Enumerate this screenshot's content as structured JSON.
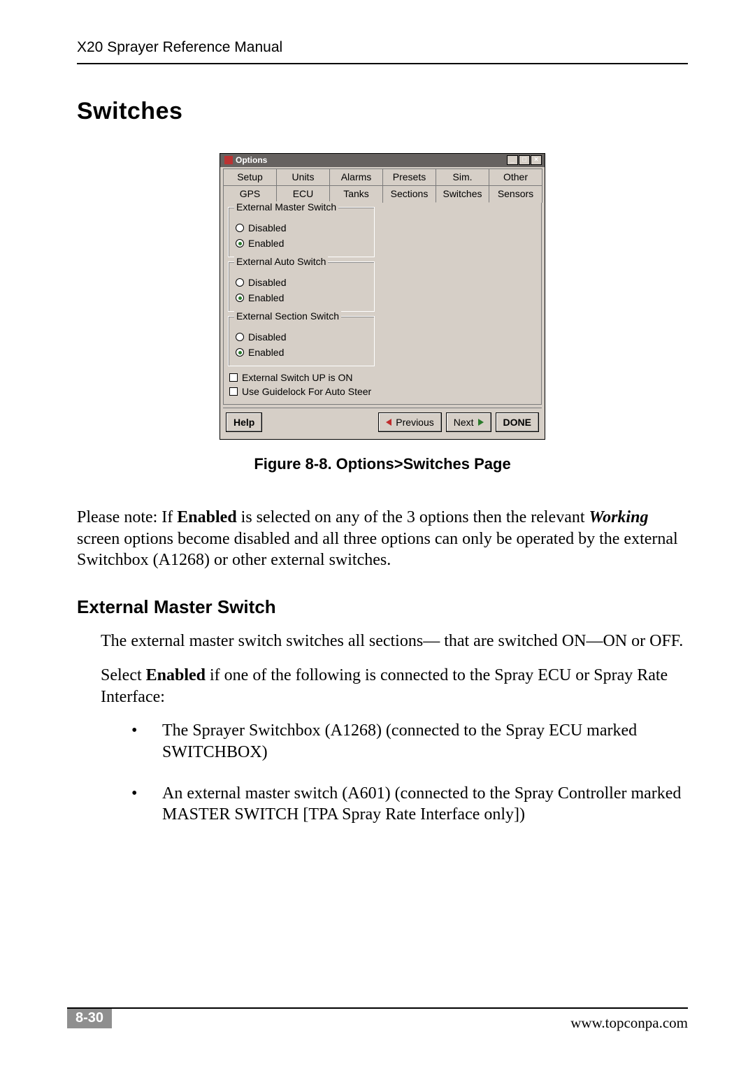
{
  "header_text": "X20 Sprayer Reference Manual",
  "section_title": "Switches",
  "dialog": {
    "title": "Options",
    "wincontrols": {
      "min": "_",
      "max": "□",
      "close": "×"
    },
    "tabs_row1": [
      "Setup",
      "Units",
      "Alarms",
      "Presets",
      "Sim.",
      "Other"
    ],
    "tabs_row2": [
      "GPS",
      "ECU",
      "Tanks",
      "Sections",
      "Switches",
      "Sensors"
    ],
    "active_tab": "Switches",
    "groups": [
      {
        "legend": "External Master Switch",
        "options": [
          "Disabled",
          "Enabled"
        ],
        "selected": 1
      },
      {
        "legend": "External Auto Switch",
        "options": [
          "Disabled",
          "Enabled"
        ],
        "selected": 1
      },
      {
        "legend": "External Section Switch",
        "options": [
          "Disabled",
          "Enabled"
        ],
        "selected": 1
      }
    ],
    "checkboxes": [
      {
        "label": "External Switch UP is ON",
        "checked": false
      },
      {
        "label": "Use Guidelock For Auto Steer",
        "checked": false
      }
    ],
    "buttons": {
      "help": "Help",
      "prev": "Previous",
      "next": "Next",
      "done": "DONE"
    }
  },
  "figure_caption": "Figure 8-8. Options>Switches Page",
  "note": {
    "prefix": "Please note: If ",
    "bold1": "Enabled",
    "mid1": " is selected on any of the 3 options then the relevant ",
    "ital": "Working",
    "mid2": " screen options become disabled and all three options can only be operated by the external Switchbox (A1268) or other external switches."
  },
  "sub_title": "External Master Switch",
  "para_ems1": "The external master switch switches all sections— that are switched ON—ON or OFF.",
  "para_ems2a": "Select ",
  "para_ems2_bold": "Enabled",
  "para_ems2b": " if one of the following is connected to the Spray ECU or Spray Rate Interface:",
  "bullets": [
    "The Sprayer Switchbox (A1268) (connected to the Spray ECU marked SWITCHBOX)",
    "An external master switch (A601) (connected to the Spray Controller marked MASTER SWITCH [TPA Spray Rate Interface only])"
  ],
  "footer": {
    "page": "8-30",
    "url": "www.topconpa.com"
  }
}
